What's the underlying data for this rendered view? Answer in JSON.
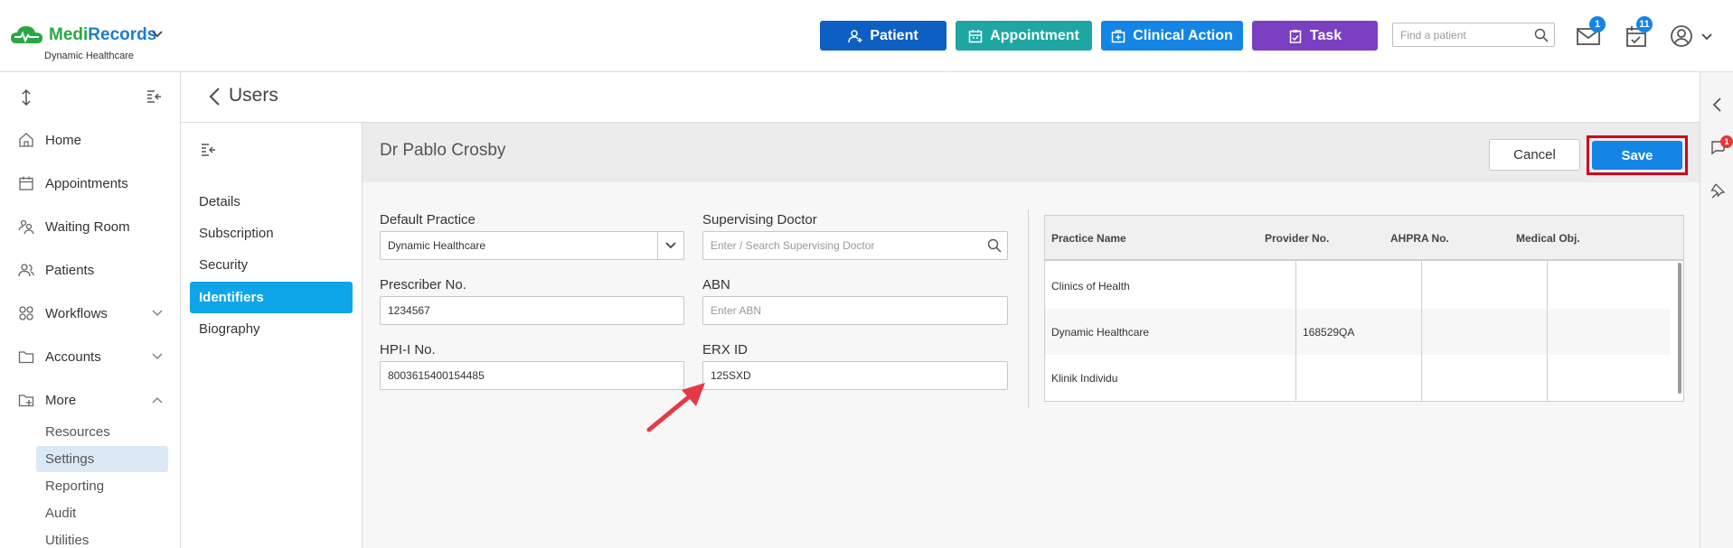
{
  "header": {
    "app_name_part1": "Medi",
    "app_name_part2": "Records",
    "practice_name": "Dynamic Healthcare",
    "buttons": {
      "patient": "Patient",
      "appointment": "Appointment",
      "clinical_action": "Clinical Action",
      "task": "Task"
    },
    "search_placeholder": "Find a patient",
    "mail_count": "1",
    "task_count": "11",
    "colors": {
      "patient": "#0d5fc4",
      "appointment": "#1ea6a3",
      "clinical_action": "#1485e5",
      "task": "#7b3fc2"
    }
  },
  "sidebar": {
    "items": [
      {
        "label": "Home",
        "icon": "home-icon"
      },
      {
        "label": "Appointments",
        "icon": "calendar-icon"
      },
      {
        "label": "Waiting Room",
        "icon": "waiting-room-icon"
      },
      {
        "label": "Patients",
        "icon": "patients-icon"
      },
      {
        "label": "Workflows",
        "icon": "workflows-icon"
      },
      {
        "label": "Accounts",
        "icon": "folder-icon"
      },
      {
        "label": "More",
        "icon": "more-icon"
      }
    ],
    "more_items": [
      "Resources",
      "Settings",
      "Reporting",
      "Audit",
      "Utilities"
    ],
    "active_sub": "Settings"
  },
  "page": {
    "title": "Users",
    "sub_nav": [
      "Details",
      "Subscription",
      "Security",
      "Identifiers",
      "Biography"
    ],
    "active_sub_nav": "Identifiers",
    "doctor_name": "Dr Pablo Crosby",
    "cancel_label": "Cancel",
    "save_label": "Save"
  },
  "form": {
    "default_practice": {
      "label": "Default Practice",
      "value": "Dynamic Healthcare"
    },
    "supervising_doctor": {
      "label": "Supervising Doctor",
      "placeholder": "Enter / Search Supervising Doctor"
    },
    "prescriber_no": {
      "label": "Prescriber No.",
      "value": "1234567"
    },
    "abn": {
      "label": "ABN",
      "placeholder": "Enter ABN"
    },
    "hpii_no": {
      "label": "HPI-I No.",
      "value": "8003615400154485"
    },
    "erx_id": {
      "label": "ERX ID",
      "value": "125SXD"
    }
  },
  "practice_table": {
    "columns": [
      "Practice Name",
      "Provider No.",
      "AHPRA No.",
      "Medical Obj."
    ],
    "rows": [
      [
        "Clinics of Health",
        "",
        "",
        ""
      ],
      [
        "Dynamic Healthcare",
        "168529QA",
        "",
        ""
      ],
      [
        "Klinik Individu",
        "",
        "",
        ""
      ]
    ]
  },
  "right_rail": {
    "chat_badge": "1"
  }
}
